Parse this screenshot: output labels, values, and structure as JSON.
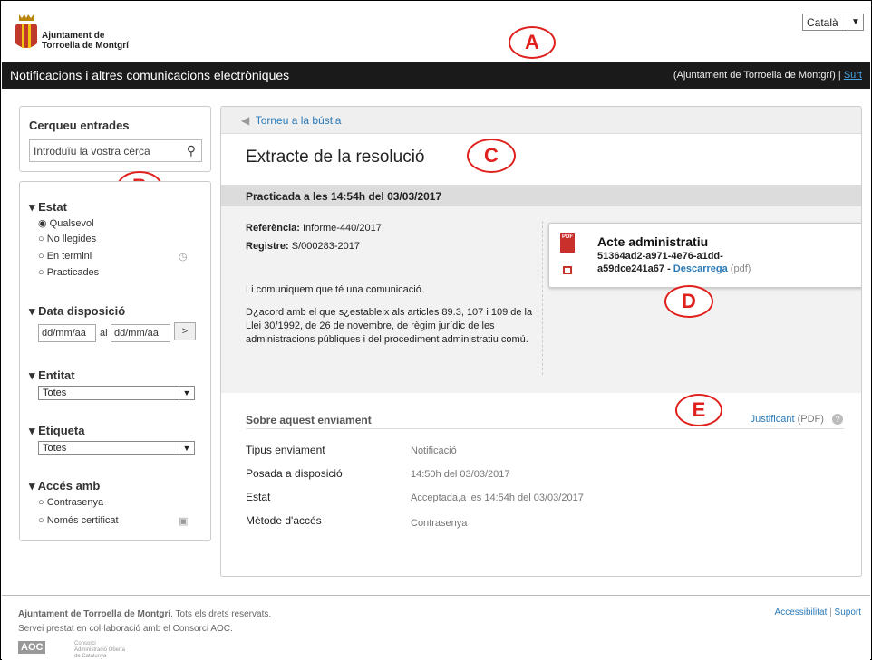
{
  "header": {
    "org_line1": "Ajuntament de",
    "org_line2": "Torroella de Montgrí",
    "language": "Català",
    "bar_title": "Notificacions i altres comunicacions electròniques",
    "user_text": " (Ajuntament de Torroella de Montgrí) |",
    "logout": "Surt"
  },
  "markers": {
    "a": "A",
    "b": "B",
    "c": "C",
    "d": "D",
    "e": "E"
  },
  "sidebar": {
    "search_title": "Cerqueu entrades",
    "search_placeholder": "Introduïu la vostra cerca",
    "estat_title": "▾ Estat",
    "estat_options": [
      "Qualsevol",
      "No llegides",
      "En termini",
      "Practicades"
    ],
    "data_title": "▾ Data disposició",
    "date_from": "dd/mm/aa",
    "date_sep": "al",
    "date_to": "dd/mm/aa",
    "go": ">",
    "entitat_title": "▾ Entitat",
    "entitat_value": "Totes",
    "etiqueta_title": "▾ Etiqueta",
    "etiqueta_value": "Totes",
    "acces_title": "▾ Accés amb",
    "acces_options": [
      "Contrasenya",
      "Només certificat"
    ]
  },
  "main": {
    "back": "Torneu a la bústia",
    "title": "Extracte de la resolució",
    "practicada": "Practicada a les 14:54h del 03/03/2017",
    "ref_label": "Referència:",
    "ref_value": "Informe-440/2017",
    "reg_label": "Registre:",
    "reg_value": "S/000283-2017",
    "p1": "Li comuniquem que té una comunicació.",
    "p2": "D¿acord amb el que s¿estableix als articles 89.3, 107 i 109 de la Llei 30/1992, de 26 de novembre, de règim jurídic de les administracions públiques i del procediment administratiu comú.",
    "doc_title": "Acte administratiu",
    "doc_id1": "51364ad2-a971-4e76-a1dd-",
    "doc_id2": "a59dce241a67 -",
    "download": "Descarrega",
    "pdf_tag": "(pdf)",
    "about_title": "Sobre aquest enviament",
    "justificant": "Justificant",
    "justificant_pdf": "(PDF)",
    "rows": [
      {
        "label": "Tipus enviament",
        "value": "Notificació"
      },
      {
        "label": "Posada a disposició",
        "value": "14:50h del 03/03/2017"
      },
      {
        "label": "Estat",
        "value": "Acceptada,a les 14:54h del 03/03/2017"
      },
      {
        "label": "Mètode d'accés",
        "value": "Contrasenya"
      }
    ]
  },
  "footer": {
    "org": "Ajuntament de Torroella de Montgrí",
    "rights": ". Tots els drets reservats.",
    "line2": "Servei prestat en col·laboració amb el Consorci AOC.",
    "accessibility": "Accessibilitat",
    "support": "Suport",
    "aoc": "AOC",
    "aoc_text": "Consorci Administració Oberta de Catalunya"
  }
}
